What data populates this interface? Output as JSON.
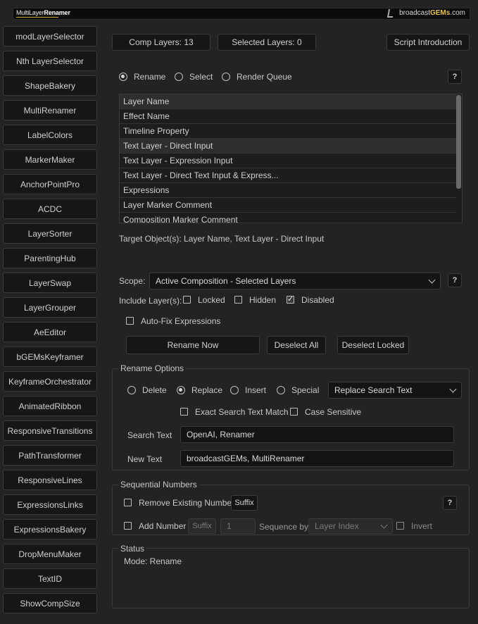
{
  "header": {
    "logo_left_prefix": "MultiLayer",
    "logo_left_bold": "Renamer",
    "logo_right_prefix": "broadcast",
    "logo_right_bold": "GEMs",
    "logo_right_suffix": ".com"
  },
  "sidebar": {
    "items": [
      "modLayerSelector",
      "Nth LayerSelector",
      "ShapeBakery",
      "MultiRenamer",
      "LabelColors",
      "MarkerMaker",
      "AnchorPointPro",
      "ACDC",
      "LayerSorter",
      "ParentingHub",
      "LayerSwap",
      "LayerGrouper",
      "AeEditor",
      "bGEMsKeyframer",
      "KeyframeOrchestrator",
      "AnimatedRibbon",
      "ResponsiveTransitions",
      "PathTransformer",
      "ResponsiveLines",
      "ExpressionsLinks",
      "ExpressionsBakery",
      "DropMenuMaker",
      "TextID",
      "ShowCompSize"
    ]
  },
  "top": {
    "comp_layers": "Comp Layers: 13",
    "selected_layers": "Selected Layers: 0",
    "script_intro": "Script Introduction"
  },
  "mode": {
    "options": [
      "Rename",
      "Select",
      "Render Queue"
    ],
    "selected": "Rename",
    "help": "?"
  },
  "targets": {
    "items": [
      "Layer Name",
      "Effect Name",
      "Timeline Property",
      "Text Layer - Direct Input",
      "Text Layer - Expression Input",
      "Text Layer - Direct Text Input & Express...",
      "Expressions",
      "Layer Marker Comment",
      "Composition Marker Comment"
    ],
    "summary": "Target Object(s): Layer Name, Text Layer - Direct Input"
  },
  "scope": {
    "label": "Scope:",
    "value": "Active Composition - Selected Layers",
    "help": "?",
    "include_label": "Include Layer(s):",
    "locked": "Locked",
    "hidden": "Hidden",
    "disabled": "Disabled",
    "disabled_checked": true,
    "auto_fix": "Auto-Fix Expressions"
  },
  "actions": {
    "rename_now": "Rename Now",
    "deselect_all": "Deselect All",
    "deselect_locked": "Deselect Locked"
  },
  "rename_options": {
    "title": "Rename Options",
    "modes": [
      "Delete",
      "Replace",
      "Insert",
      "Special"
    ],
    "selected": "Replace",
    "dropdown": "Replace Search Text",
    "exact_match": "Exact Search Text Match",
    "case_sensitive": "Case Sensitive",
    "search_label": "Search Text",
    "search_value": "OpenAI, Renamer",
    "new_label": "New Text",
    "new_value": "broadcastGEMs, MultiRenamer"
  },
  "sequential": {
    "title": "Sequential Numbers",
    "remove_existing": "Remove Existing Number",
    "suffix1": "Suffix",
    "help": "?",
    "add_number": "Add Number",
    "suffix2": "Suffix",
    "start_value": "1",
    "sequence_label": "Sequence by:",
    "sequence_value": "Layer Index",
    "invert": "Invert"
  },
  "status": {
    "title": "Status",
    "text": "Mode: Rename"
  }
}
